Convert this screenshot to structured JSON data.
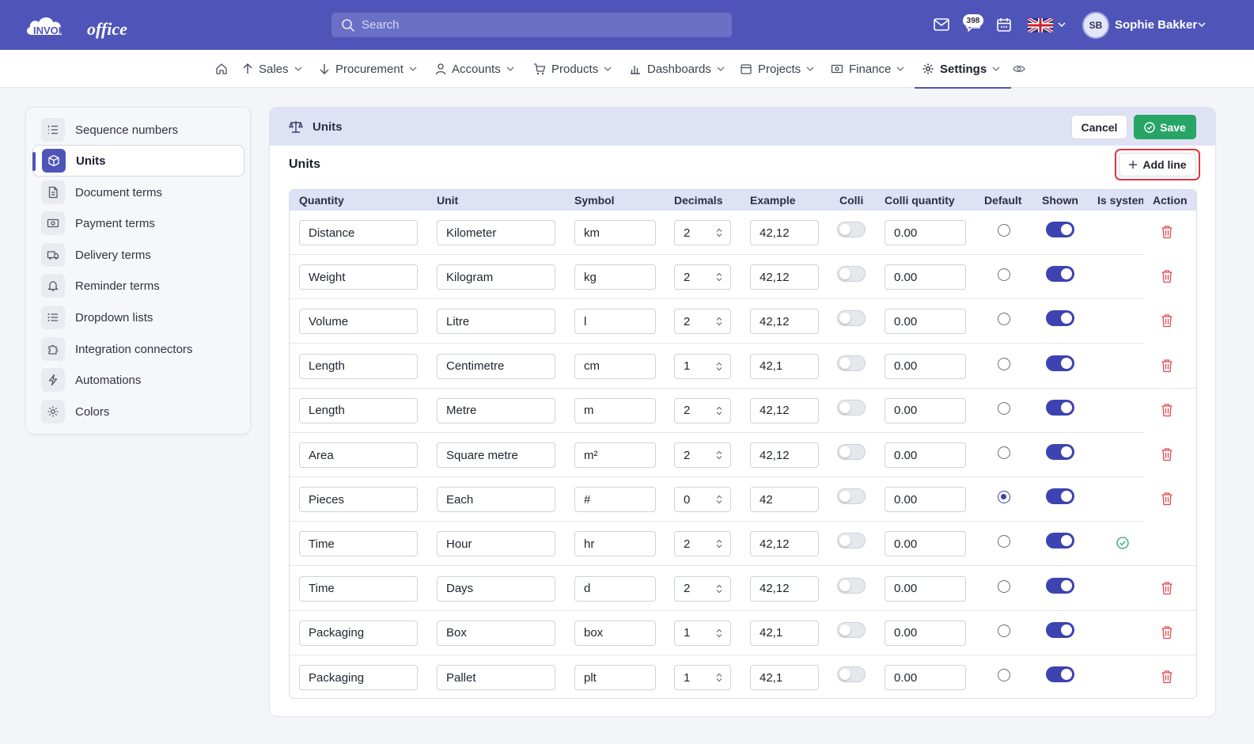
{
  "app": {
    "logo_left": "INVOICE",
    "logo_right": "office"
  },
  "header": {
    "search_placeholder": "Search",
    "notification_count": "398",
    "user_initials": "SB",
    "user_name": "Sophie Bakker"
  },
  "nav": {
    "items": [
      {
        "label": "Sales"
      },
      {
        "label": "Procurement"
      },
      {
        "label": "Accounts"
      },
      {
        "label": "Products"
      },
      {
        "label": "Dashboards"
      },
      {
        "label": "Projects"
      },
      {
        "label": "Finance"
      },
      {
        "label": "Settings"
      }
    ],
    "active": "Settings"
  },
  "sidebar": {
    "items": [
      {
        "label": "Sequence numbers",
        "icon": "list-ordered-icon"
      },
      {
        "label": "Units",
        "icon": "cube-icon"
      },
      {
        "label": "Document terms",
        "icon": "document-icon"
      },
      {
        "label": "Payment terms",
        "icon": "banknote-icon"
      },
      {
        "label": "Delivery terms",
        "icon": "truck-icon"
      },
      {
        "label": "Reminder terms",
        "icon": "bell-icon"
      },
      {
        "label": "Dropdown lists",
        "icon": "list-icon"
      },
      {
        "label": "Integration connectors",
        "icon": "puzzle-icon"
      },
      {
        "label": "Automations",
        "icon": "lightning-icon"
      },
      {
        "label": "Colors",
        "icon": "gear-icon"
      }
    ],
    "active": "Units"
  },
  "panel": {
    "title": "Units",
    "cancel_label": "Cancel",
    "save_label": "Save",
    "section_title": "Units",
    "add_line_label": "Add line"
  },
  "table": {
    "columns": [
      "Quantity",
      "Unit",
      "Symbol",
      "Decimals",
      "Example",
      "Colli",
      "Colli quantity",
      "Default",
      "Shown",
      "Is system",
      "Action"
    ],
    "rows": [
      {
        "quantity": "Distance",
        "unit": "Kilometer",
        "symbol": "km",
        "decimals": "2",
        "example": "42,12",
        "colli": false,
        "colli_quantity": "0.00",
        "default": false,
        "shown": true,
        "is_system": false
      },
      {
        "quantity": "Weight",
        "unit": "Kilogram",
        "symbol": "kg",
        "decimals": "2",
        "example": "42,12",
        "colli": false,
        "colli_quantity": "0.00",
        "default": false,
        "shown": true,
        "is_system": false
      },
      {
        "quantity": "Volume",
        "unit": "Litre",
        "symbol": "l",
        "decimals": "2",
        "example": "42,12",
        "colli": false,
        "colli_quantity": "0.00",
        "default": false,
        "shown": true,
        "is_system": false
      },
      {
        "quantity": "Length",
        "unit": "Centimetre",
        "symbol": "cm",
        "decimals": "1",
        "example": "42,1",
        "colli": false,
        "colli_quantity": "0.00",
        "default": false,
        "shown": true,
        "is_system": false
      },
      {
        "quantity": "Length",
        "unit": "Metre",
        "symbol": "m",
        "decimals": "2",
        "example": "42,12",
        "colli": false,
        "colli_quantity": "0.00",
        "default": false,
        "shown": true,
        "is_system": false
      },
      {
        "quantity": "Area",
        "unit": "Square metre",
        "symbol": "m²",
        "decimals": "2",
        "example": "42,12",
        "colli": false,
        "colli_quantity": "0.00",
        "default": false,
        "shown": true,
        "is_system": false
      },
      {
        "quantity": "Pieces",
        "unit": "Each",
        "symbol": "#",
        "decimals": "0",
        "example": "42",
        "colli": false,
        "colli_quantity": "0.00",
        "default": true,
        "shown": true,
        "is_system": false
      },
      {
        "quantity": "Time",
        "unit": "Hour",
        "symbol": "hr",
        "decimals": "2",
        "example": "42,12",
        "colli": false,
        "colli_quantity": "0.00",
        "default": false,
        "shown": true,
        "is_system": true
      },
      {
        "quantity": "Time",
        "unit": "Days",
        "symbol": "d",
        "decimals": "2",
        "example": "42,12",
        "colli": false,
        "colli_quantity": "0.00",
        "default": false,
        "shown": true,
        "is_system": false
      },
      {
        "quantity": "Packaging",
        "unit": "Box",
        "symbol": "box",
        "decimals": "1",
        "example": "42,1",
        "colli": false,
        "colli_quantity": "0.00",
        "default": false,
        "shown": true,
        "is_system": false
      },
      {
        "quantity": "Packaging",
        "unit": "Pallet",
        "symbol": "plt",
        "decimals": "1",
        "example": "42,1",
        "colli": false,
        "colli_quantity": "0.00",
        "default": false,
        "shown": true,
        "is_system": false
      }
    ]
  },
  "colors": {
    "brand": "#4f55b8",
    "save": "#27a567",
    "delete": "#e5484d",
    "system_check": "#27a567"
  }
}
